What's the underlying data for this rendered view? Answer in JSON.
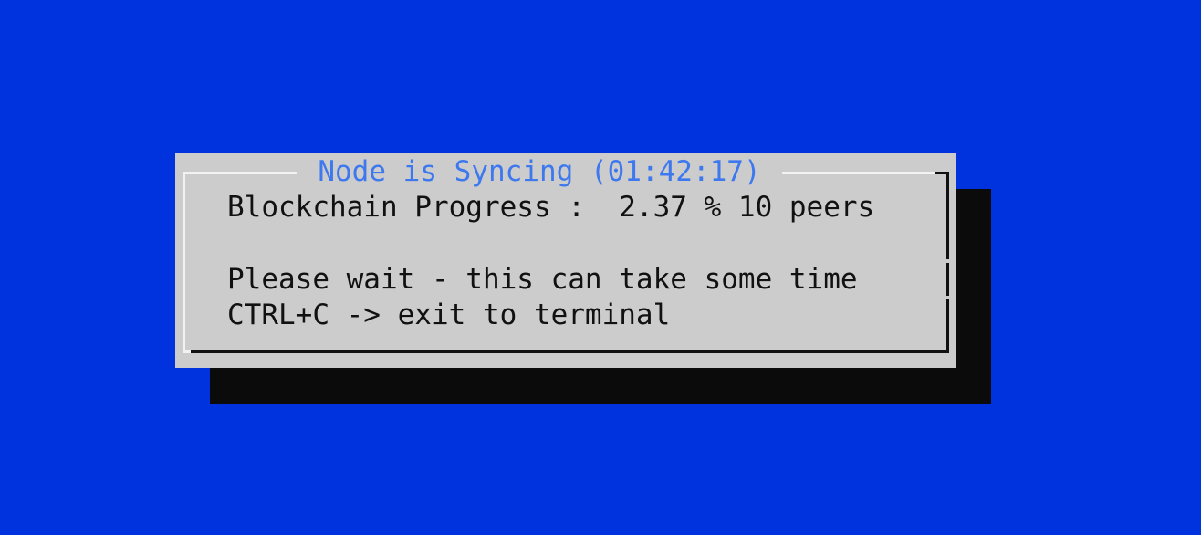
{
  "dialog": {
    "title": "Node is Syncing (01:42:17)",
    "progress_line": "Blockchain Progress :  2.37 % 10 peers",
    "wait_line": "Please wait - this can take some time",
    "hint_line": "CTRL+C -> exit to terminal"
  },
  "colors": {
    "background": "#0033dd",
    "dialog": "#cccccc",
    "shadow": "#0b0b0b",
    "title": "#3d78ee",
    "text": "#111111"
  }
}
